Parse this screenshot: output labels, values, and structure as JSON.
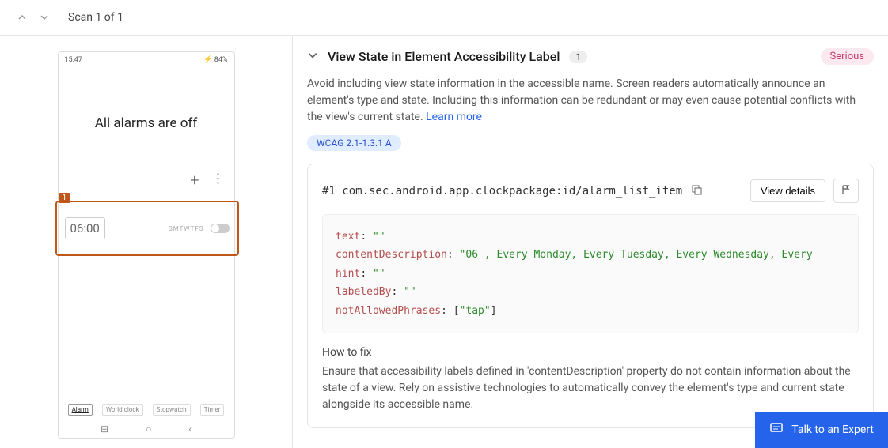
{
  "topbar": {
    "scan_label": "Scan 1 of 1"
  },
  "phone": {
    "status_time": "15:47",
    "status_battery": "84%",
    "title": "All alarms are off",
    "alarm_time": "06:00",
    "days": "SMTWTFS",
    "highlight_badge": "1",
    "tabs": [
      "Alarm",
      "World clock",
      "Stopwatch",
      "Timer"
    ]
  },
  "issue": {
    "title": "View State in Element Accessibility Label",
    "count": "1",
    "severity": "Serious",
    "description": "Avoid including view state information in the accessible name. Screen readers automatically announce an element's type and state. Including this information can be redundant or may even cause potential conflicts with the view's current state.",
    "learn_more": "Learn more",
    "wcag": "WCAG 2.1-1.3.1 A",
    "element_id": "#1 com.sec.android.app.clockpackage:id/alarm_list_item",
    "view_details": "View details",
    "code": {
      "text_k": "text",
      "text_v": "\"\"",
      "cd_k": "contentDescription",
      "cd_v": "\"06 , Every Monday, Every Tuesday, Every Wednesday, Every",
      "hint_k": "hint",
      "hint_v": "\"\"",
      "lb_k": "labeledBy",
      "lb_v": "\"\"",
      "nap_k": "notAllowedPhrases",
      "nap_v": "\"tap\""
    },
    "howto_title": "How to fix",
    "howto_text": "Ensure that accessibility labels defined in 'contentDescription' property do not contain information about the state of a view. Rely on assistive technologies to automatically convey the element's type and current state alongside its accessible name."
  },
  "chat": {
    "label": "Talk to an Expert"
  }
}
